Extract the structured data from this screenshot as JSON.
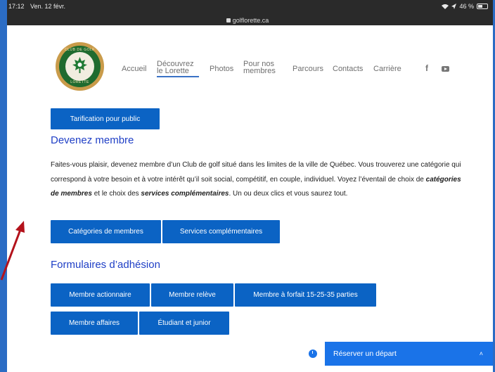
{
  "status_bar": {
    "time": "17:12",
    "date": "Ven. 12 févr.",
    "url": "golflorette.ca",
    "battery": "46 %"
  },
  "logo": {
    "top_text": "CLUB DE GOLF",
    "bottom_text": "LORETTE"
  },
  "nav": {
    "accueil": "Accueil",
    "decouvrez_1": "Découvrez",
    "decouvrez_2": "le Lorette",
    "photos": "Photos",
    "pournos_1": "Pour nos",
    "pournos_2": "membres",
    "parcours": "Parcours",
    "contacts": "Contacts",
    "carriere": "Carrière",
    "facebook": "f"
  },
  "content": {
    "tarif_button": "Tarification pour public",
    "heading_devenez": "Devenez membre",
    "para_1": "Faites-vous plaisir, devenez membre d’un Club de golf situé dans les limites de la ville de Québec.  Vous trouverez une catégorie qui correspond à votre besoin et à votre intérêt qu’il soit social, compétitif, en couple, individuel.  Voyez l’éventail de choix de ",
    "para_bold_1": "catégories de membres",
    "para_2": " et le choix des ",
    "para_bold_2": "services complémentaires",
    "para_3": ". Un ou deux clics et vous saurez tout.",
    "btn_categories": "Catégories de membres",
    "btn_services": "Services complémentaires",
    "heading_formulaires": "Formulaires d’adhésion",
    "btn_actionnaire": "Membre actionnaire",
    "btn_releve": "Membre relève",
    "btn_forfait": "Membre à forfait 15-25-35 parties",
    "btn_affaires": "Membre affaires",
    "btn_etudiant": "Étudiant et junior"
  },
  "reserve_widget": {
    "label": "Réserver un départ",
    "chevron": "˄"
  },
  "colors": {
    "frame": "#2b6cc4",
    "button": "#0b63c4",
    "heading": "#1f3fc6",
    "widget": "#1a73e8",
    "arrow": "#b3121b"
  }
}
